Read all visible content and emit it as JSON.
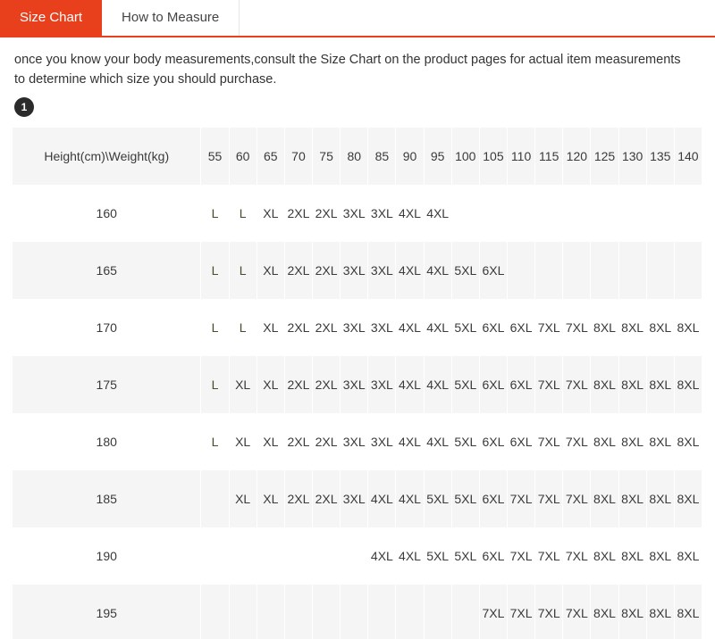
{
  "tabs": [
    {
      "label": "Size Chart",
      "active": true
    },
    {
      "label": "How to Measure",
      "active": false
    }
  ],
  "intro": {
    "paragraph": "once you know your body measurements,consult the Size Chart on the product pages for actual item measurements to determine which size you should purchase.",
    "step_badge": "1"
  },
  "chart_data": {
    "type": "table",
    "title": "Size Chart",
    "corner_header": "Height(cm)\\Weight(kg)",
    "xlabel": "Weight(kg)",
    "ylabel": "Height(cm)",
    "columns": [
      "55",
      "60",
      "65",
      "70",
      "75",
      "80",
      "85",
      "90",
      "95",
      "100",
      "105",
      "110",
      "115",
      "120",
      "125",
      "130",
      "135",
      "140"
    ],
    "rows": [
      {
        "height": "160",
        "values": [
          "L",
          "L",
          "XL",
          "2XL",
          "2XL",
          "3XL",
          "3XL",
          "4XL",
          "4XL",
          "",
          "",
          "",
          "",
          "",
          "",
          "",
          "",
          ""
        ]
      },
      {
        "height": "165",
        "values": [
          "L",
          "L",
          "XL",
          "2XL",
          "2XL",
          "3XL",
          "3XL",
          "4XL",
          "4XL",
          "5XL",
          "6XL",
          "",
          "",
          "",
          "",
          "",
          "",
          ""
        ]
      },
      {
        "height": "170",
        "values": [
          "L",
          "L",
          "XL",
          "2XL",
          "2XL",
          "3XL",
          "3XL",
          "4XL",
          "4XL",
          "5XL",
          "6XL",
          "6XL",
          "7XL",
          "7XL",
          "8XL",
          "8XL",
          "8XL",
          "8XL"
        ]
      },
      {
        "height": "175",
        "values": [
          "L",
          "XL",
          "XL",
          "2XL",
          "2XL",
          "3XL",
          "3XL",
          "4XL",
          "4XL",
          "5XL",
          "6XL",
          "6XL",
          "7XL",
          "7XL",
          "8XL",
          "8XL",
          "8XL",
          "8XL"
        ]
      },
      {
        "height": "180",
        "values": [
          "L",
          "XL",
          "XL",
          "2XL",
          "2XL",
          "3XL",
          "3XL",
          "4XL",
          "4XL",
          "5XL",
          "6XL",
          "6XL",
          "7XL",
          "7XL",
          "8XL",
          "8XL",
          "8XL",
          "8XL"
        ]
      },
      {
        "height": "185",
        "values": [
          "",
          "XL",
          "XL",
          "2XL",
          "2XL",
          "3XL",
          "4XL",
          "4XL",
          "5XL",
          "5XL",
          "6XL",
          "7XL",
          "7XL",
          "7XL",
          "8XL",
          "8XL",
          "8XL",
          "8XL"
        ]
      },
      {
        "height": "190",
        "values": [
          "",
          "",
          "",
          "",
          "",
          "",
          "4XL",
          "4XL",
          "5XL",
          "5XL",
          "6XL",
          "7XL",
          "7XL",
          "7XL",
          "8XL",
          "8XL",
          "8XL",
          "8XL"
        ]
      },
      {
        "height": "195",
        "values": [
          "",
          "",
          "",
          "",
          "",
          "",
          "",
          "",
          "",
          "",
          "7XL",
          "7XL",
          "7XL",
          "7XL",
          "8XL",
          "8XL",
          "8XL",
          "8XL"
        ]
      }
    ]
  },
  "colors": {
    "accent": "#e8401c",
    "badge": "#2b2b2b",
    "stripe": "#f5f5f5",
    "text": "#333333"
  }
}
